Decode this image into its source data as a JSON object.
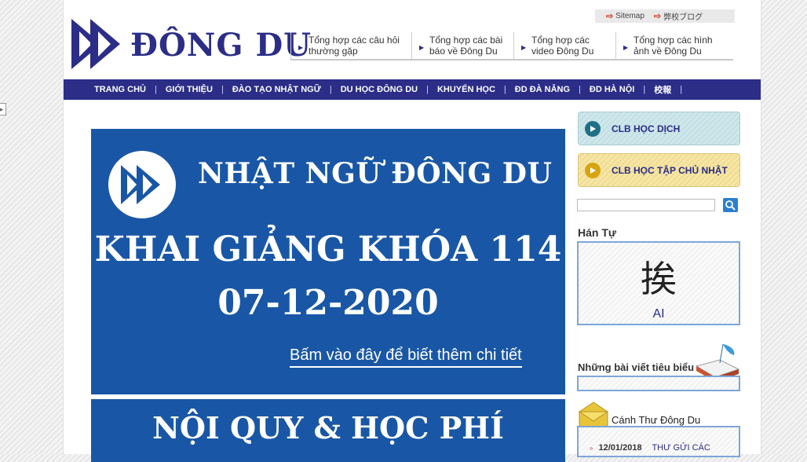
{
  "header": {
    "top_links": [
      {
        "label": "Sitemap"
      },
      {
        "label": "弊校ブログ"
      }
    ],
    "logo_text": "ĐÔNG DU",
    "quick_links": [
      {
        "line1": "Tổng hợp các câu hỏi",
        "line2": "thường gặp"
      },
      {
        "line1": "Tổng hợp các bài",
        "line2": "báo về Đông Du"
      },
      {
        "line1": "Tổng hợp các",
        "line2": "video Đông Du"
      },
      {
        "line1": "Tổng hợp các hình",
        "line2": "ảnh về Đông Du"
      }
    ]
  },
  "nav": {
    "items": [
      "TRANG CHỦ",
      "GIỚI THIỆU",
      "ĐÀO TẠO NHẬT NGỮ",
      "DU HỌC ĐÔNG DU",
      "KHUYẾN HỌC",
      "ĐD ĐÀ NẴNG",
      "ĐD HÀ NỘI",
      "校報"
    ]
  },
  "banner1": {
    "title": "NHẬT NGỮ ĐÔNG DU",
    "course": "KHAI GIẢNG KHÓA 114",
    "date": "07-12-2020",
    "more_link": "Bấm vào đây để biết thêm chi tiết"
  },
  "banner2": {
    "title": "NỘI QUY & HỌC PHÍ"
  },
  "sidebar": {
    "clubs": [
      {
        "label": "CLB HỌC DỊCH"
      },
      {
        "label": "CLB HỌC TẬP CHỦ NHẬT"
      }
    ],
    "search": {
      "placeholder": ""
    },
    "kanji": {
      "title": "Hán Tự",
      "character": "挨",
      "reading": "AI"
    },
    "featured": {
      "title": "Những bài viết tiêu biểu"
    },
    "letters": {
      "title": "Cánh Thư Đông Du",
      "items": [
        {
          "date": "12/01/2018",
          "text": "THƯ GỬI CÁC"
        }
      ]
    }
  },
  "colors": {
    "brand_navy": "#2b2d87",
    "banner_blue": "#1957a6",
    "accent_red": "#d23b2a"
  }
}
